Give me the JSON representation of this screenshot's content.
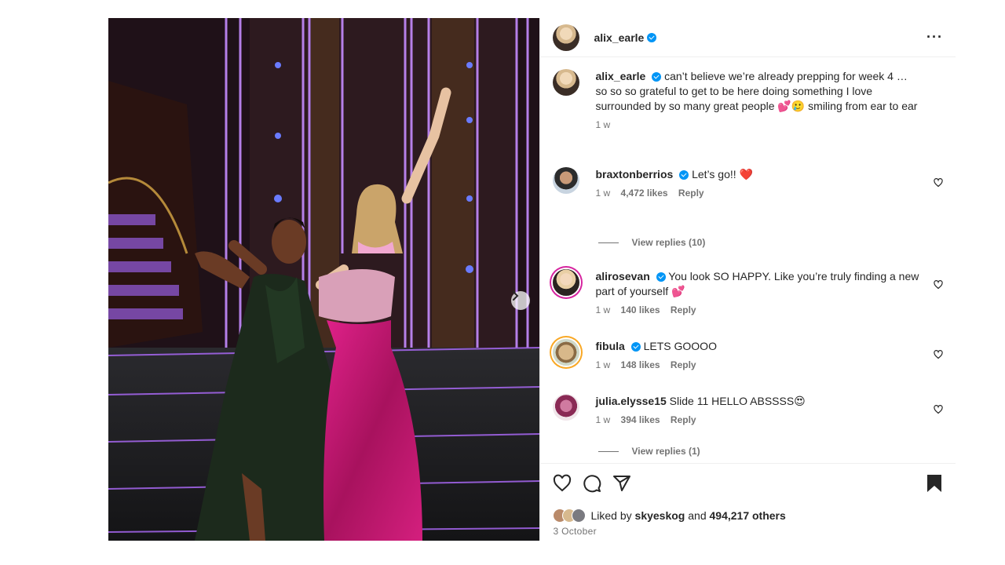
{
  "post": {
    "author": "alix_earle",
    "more_label": "···",
    "caption": {
      "user": "alix_earle",
      "text": "can’t believe we’re already prepping for week 4 … so so so grateful to get to be here doing something I love surrounded by so many great people 💕🥲 smiling from ear to ear",
      "time": "1 w"
    },
    "comments": [
      {
        "user": "braxtonberrios",
        "text": "Let’s go!! ❤️",
        "time": "1 w",
        "likes": "4,472 likes",
        "reply": "Reply",
        "verified": true,
        "view_replies": "View replies (10)"
      },
      {
        "user": "alirosevan",
        "text": "You look SO HAPPY. Like you’re truly finding a new part of yourself 💕",
        "time": "1 w",
        "likes": "140 likes",
        "reply": "Reply",
        "verified": true
      },
      {
        "user": "fibula",
        "text": "LETS GOOOO",
        "time": "1 w",
        "likes": "148 likes",
        "reply": "Reply",
        "verified": true
      },
      {
        "user": "julia.elysse15",
        "text": "Slide 11 HELLO ABSSSS😍",
        "time": "1 w",
        "likes": "394 likes",
        "reply": "Reply",
        "verified": false,
        "view_replies": "View replies (1)"
      }
    ],
    "liked_by_prefix": "Liked by",
    "liked_by_user": "skyeskog",
    "liked_by_and": "and",
    "liked_by_others": "494,217 others",
    "date": "3 October"
  },
  "colors": {
    "verified": "#0095f6",
    "heart": "#ed4956",
    "text": "#262626",
    "muted": "#737373"
  },
  "icons": [
    "verified-icon",
    "more-icon",
    "heart-icon",
    "comment-icon",
    "share-icon",
    "bookmark-icon",
    "chevron-right-icon"
  ]
}
